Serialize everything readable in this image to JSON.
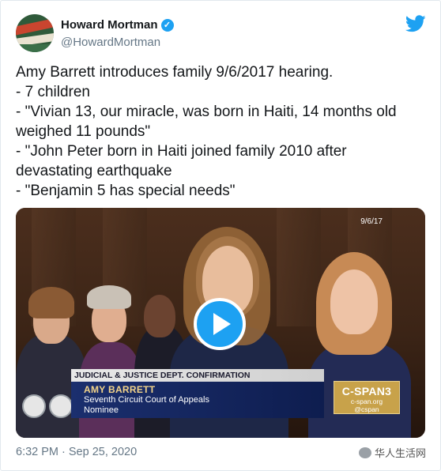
{
  "author": {
    "display_name": "Howard Mortman",
    "handle": "@HowardMortman",
    "verified_mark": "✓"
  },
  "tweet": {
    "text": "Amy Barrett introduces family 9/6/2017 hearing.\n- 7 children\n- \"Vivian 13, our miracle, was born in Haiti, 14 months old weighed 11 pounds\"\n- \"John Peter born in Haiti joined family 2010 after devastating earthquake\n- \"Benjamin 5 has special needs\"",
    "timestamp": "6:32 PM · Sep 25, 2020"
  },
  "media": {
    "date_overlay": "9/6/17",
    "lower_third": {
      "banner": "JUDICIAL & JUSTICE DEPT. CONFIRMATION",
      "name": "AMY BARRETT",
      "line1": "Seventh Circuit Court of Appeals",
      "line2": "Nominee"
    },
    "network_logo": {
      "title": "C-SPAN3",
      "url": "c-span.org",
      "handle": "@cspan"
    }
  },
  "watermark": {
    "text": "华人生活网"
  },
  "colors": {
    "twitter_blue": "#1da1f2",
    "text_primary": "#14171a",
    "text_secondary": "#657786"
  },
  "icons": {
    "brand": "twitter-bird-icon",
    "play": "play-icon",
    "verified": "verified-badge-icon"
  }
}
